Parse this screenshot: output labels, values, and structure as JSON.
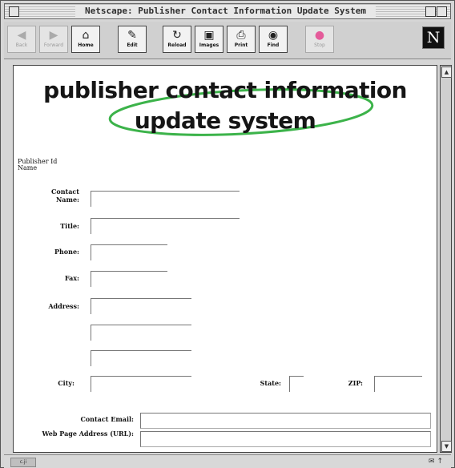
{
  "window": {
    "title": "Netscape: Publisher Contact Information Update System"
  },
  "toolbar": {
    "buttons": [
      {
        "label": "Back",
        "icon": "back-arrow-icon",
        "enabled": false
      },
      {
        "label": "Forward",
        "icon": "forward-arrow-icon",
        "enabled": false
      },
      {
        "label": "Home",
        "icon": "home-icon",
        "enabled": true
      },
      {
        "label": "Edit",
        "icon": "pencil-icon",
        "enabled": true
      },
      {
        "label": "Reload",
        "icon": "reload-icon",
        "enabled": true
      },
      {
        "label": "Images",
        "icon": "images-icon",
        "enabled": true
      },
      {
        "label": "Print",
        "icon": "printer-icon",
        "enabled": true
      },
      {
        "label": "Find",
        "icon": "binoculars-icon",
        "enabled": true
      },
      {
        "label": "Stop",
        "icon": "stop-icon",
        "enabled": false
      }
    ],
    "logo": "N"
  },
  "banner": {
    "line1": "publisher contact information",
    "line2": "update system",
    "swoosh_color": "#3cb34a"
  },
  "form": {
    "publisher_id_label": "Publisher Id",
    "name_label": "Name",
    "contact_name_label": "Contact Name:",
    "title_label": "Title:",
    "phone_label": "Phone:",
    "fax_label": "Fax:",
    "address_label": "Address:",
    "city_label": "City:",
    "state_label": "State:",
    "zip_label": "ZIP:",
    "contact_email_label": "Contact Email:",
    "web_page_label": "Web Page Address (URL):",
    "values": {
      "contact_name": "",
      "title": "",
      "phone": "",
      "fax": "",
      "address1": "",
      "address2": "",
      "address3": "",
      "city": "",
      "state": "",
      "zip": "",
      "email": "",
      "url": ""
    }
  },
  "status": {
    "left": "c.ji"
  }
}
